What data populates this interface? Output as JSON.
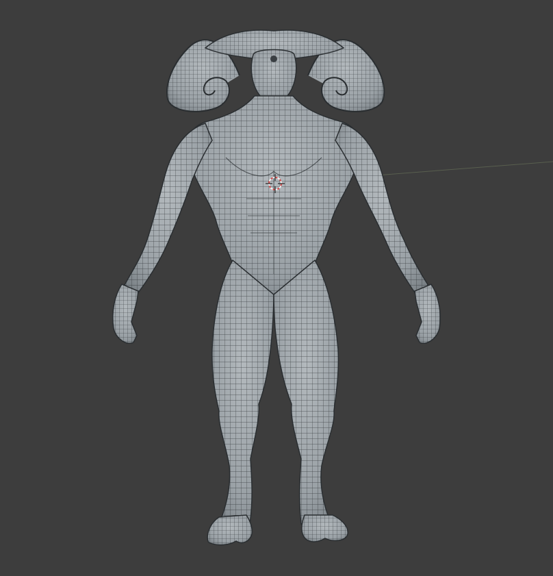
{
  "viewport": {
    "background_color": "#3d3d3d",
    "mesh_fill_color": "#a7adb1",
    "mesh_shadow_color": "#7f868b",
    "wire_color": "#1f2326",
    "horizon_line_color": "#595f4f",
    "cursor_colors": {
      "ring_red": "#d24545",
      "ring_white": "#f2f2f2",
      "cross": "#2a2a2a"
    }
  },
  "model": {
    "icon": "demon-creature-mesh",
    "view": "front-orthographic",
    "shading": "solid-wireframe-overlay",
    "parts": [
      "horns",
      "head",
      "torso",
      "arms",
      "hands",
      "legs",
      "hooves"
    ]
  },
  "cursor": {
    "icon": "3d-cursor-icon"
  }
}
